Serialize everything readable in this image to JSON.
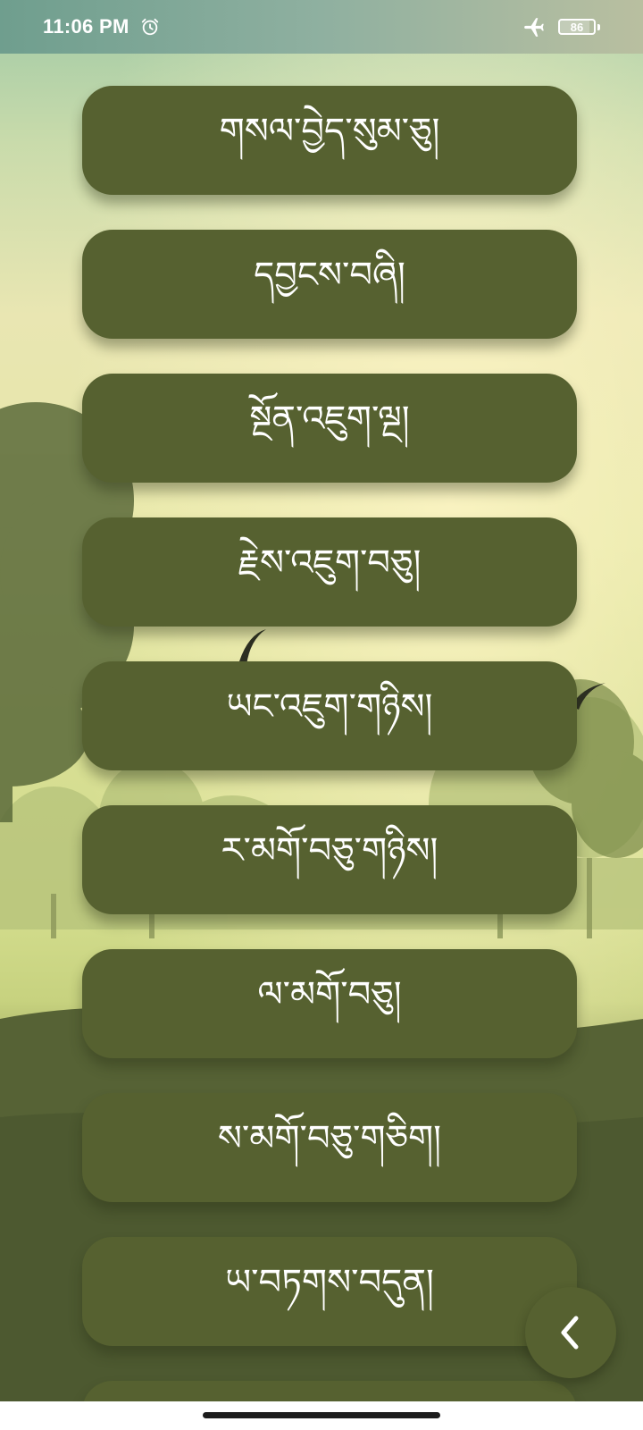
{
  "status_bar": {
    "time": "11:06 PM",
    "alarm_icon": "alarm-clock-icon",
    "airplane_icon": "airplane-mode-icon",
    "battery_level": "86",
    "battery_fraction": 0.86
  },
  "menu": {
    "items": [
      {
        "label": "གསལ་བྱེད་སུམ་ཅུ།"
      },
      {
        "label": "དབྱངས་བཞི།"
      },
      {
        "label": "སྔོན་འཇུག་ལྔ།"
      },
      {
        "label": "རྗེས་འཇུག་བཅུ།"
      },
      {
        "label": "ཡང་འཇུག་གཉིས།"
      },
      {
        "label": "ར་མགོ་བཅུ་གཉིས།"
      },
      {
        "label": "ལ་མགོ་བཅུ།"
      },
      {
        "label": "ས་མགོ་བཅུ་གཅིག།"
      },
      {
        "label": "ཡ་བཏགས་བདུན།"
      },
      {
        "label": ""
      }
    ]
  },
  "back_button": {
    "icon": "chevron-left-icon"
  },
  "colors": {
    "button": "#566130",
    "text": "#ffffff"
  }
}
